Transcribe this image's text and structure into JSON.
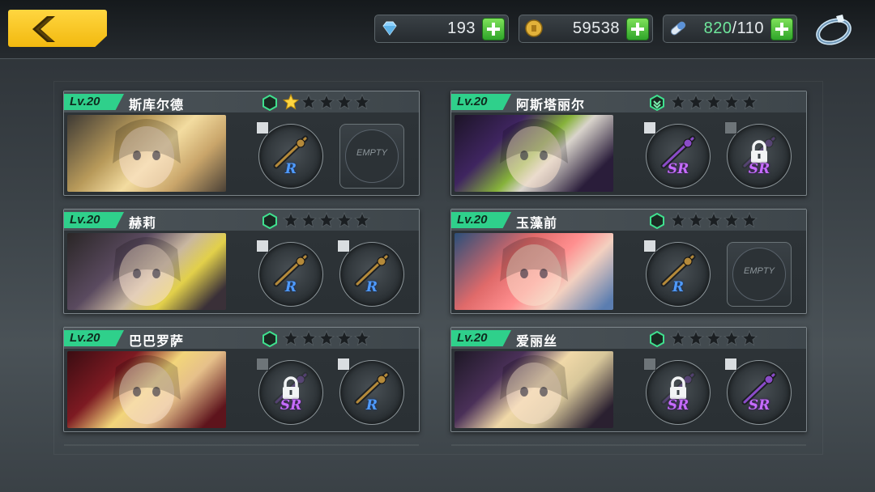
{
  "currencies": {
    "diamonds": "193",
    "gold": "59538",
    "stamina_current": "820",
    "stamina_max": "/110"
  },
  "colors": {
    "accent": "#f2b90f",
    "level_badge": "#2fd08b",
    "rarity_r": "#4f9bff",
    "rarity_sr": "#c66cff",
    "star_filled": "#ffd640"
  },
  "icons": {
    "back": "chevron-left-icon",
    "diamond": "diamond-icon",
    "gold": "gold-coin-icon",
    "stamina": "stamina-capsule-icon",
    "ring": "ring-icon",
    "plus": "plus-icon",
    "lock": "lock-icon"
  },
  "cards": [
    {
      "level": "Lv.20",
      "name": "斯库尔德",
      "stars_filled": 1,
      "hex_style": "plain",
      "slot1": {
        "rarity": "R",
        "locked": false,
        "empty": false
      },
      "slot2": {
        "rarity": "",
        "locked": false,
        "empty": true,
        "label": "EMPTY"
      }
    },
    {
      "level": "Lv.20",
      "name": "阿斯塔丽尔",
      "stars_filled": 0,
      "hex_style": "rank-up",
      "slot1": {
        "rarity": "SR",
        "locked": false,
        "empty": false
      },
      "slot2": {
        "rarity": "SR",
        "locked": true,
        "empty": false
      }
    },
    {
      "level": "Lv.20",
      "name": "赫莉",
      "stars_filled": 0,
      "hex_style": "plain",
      "slot1": {
        "rarity": "R",
        "locked": false,
        "empty": false
      },
      "slot2": {
        "rarity": "R",
        "locked": false,
        "empty": false
      }
    },
    {
      "level": "Lv.20",
      "name": "玉藻前",
      "stars_filled": 0,
      "hex_style": "plain",
      "slot1": {
        "rarity": "R",
        "locked": false,
        "empty": false
      },
      "slot2": {
        "rarity": "",
        "locked": false,
        "empty": true,
        "label": "EMPTY"
      }
    },
    {
      "level": "Lv.20",
      "name": "巴巴罗萨",
      "stars_filled": 0,
      "hex_style": "plain",
      "slot1": {
        "rarity": "SR",
        "locked": true,
        "empty": false
      },
      "slot2": {
        "rarity": "R",
        "locked": false,
        "empty": false
      }
    },
    {
      "level": "Lv.20",
      "name": "爱丽丝",
      "stars_filled": 0,
      "hex_style": "plain",
      "slot1": {
        "rarity": "SR",
        "locked": true,
        "empty": false
      },
      "slot2": {
        "rarity": "SR",
        "locked": false,
        "empty": false
      }
    }
  ]
}
